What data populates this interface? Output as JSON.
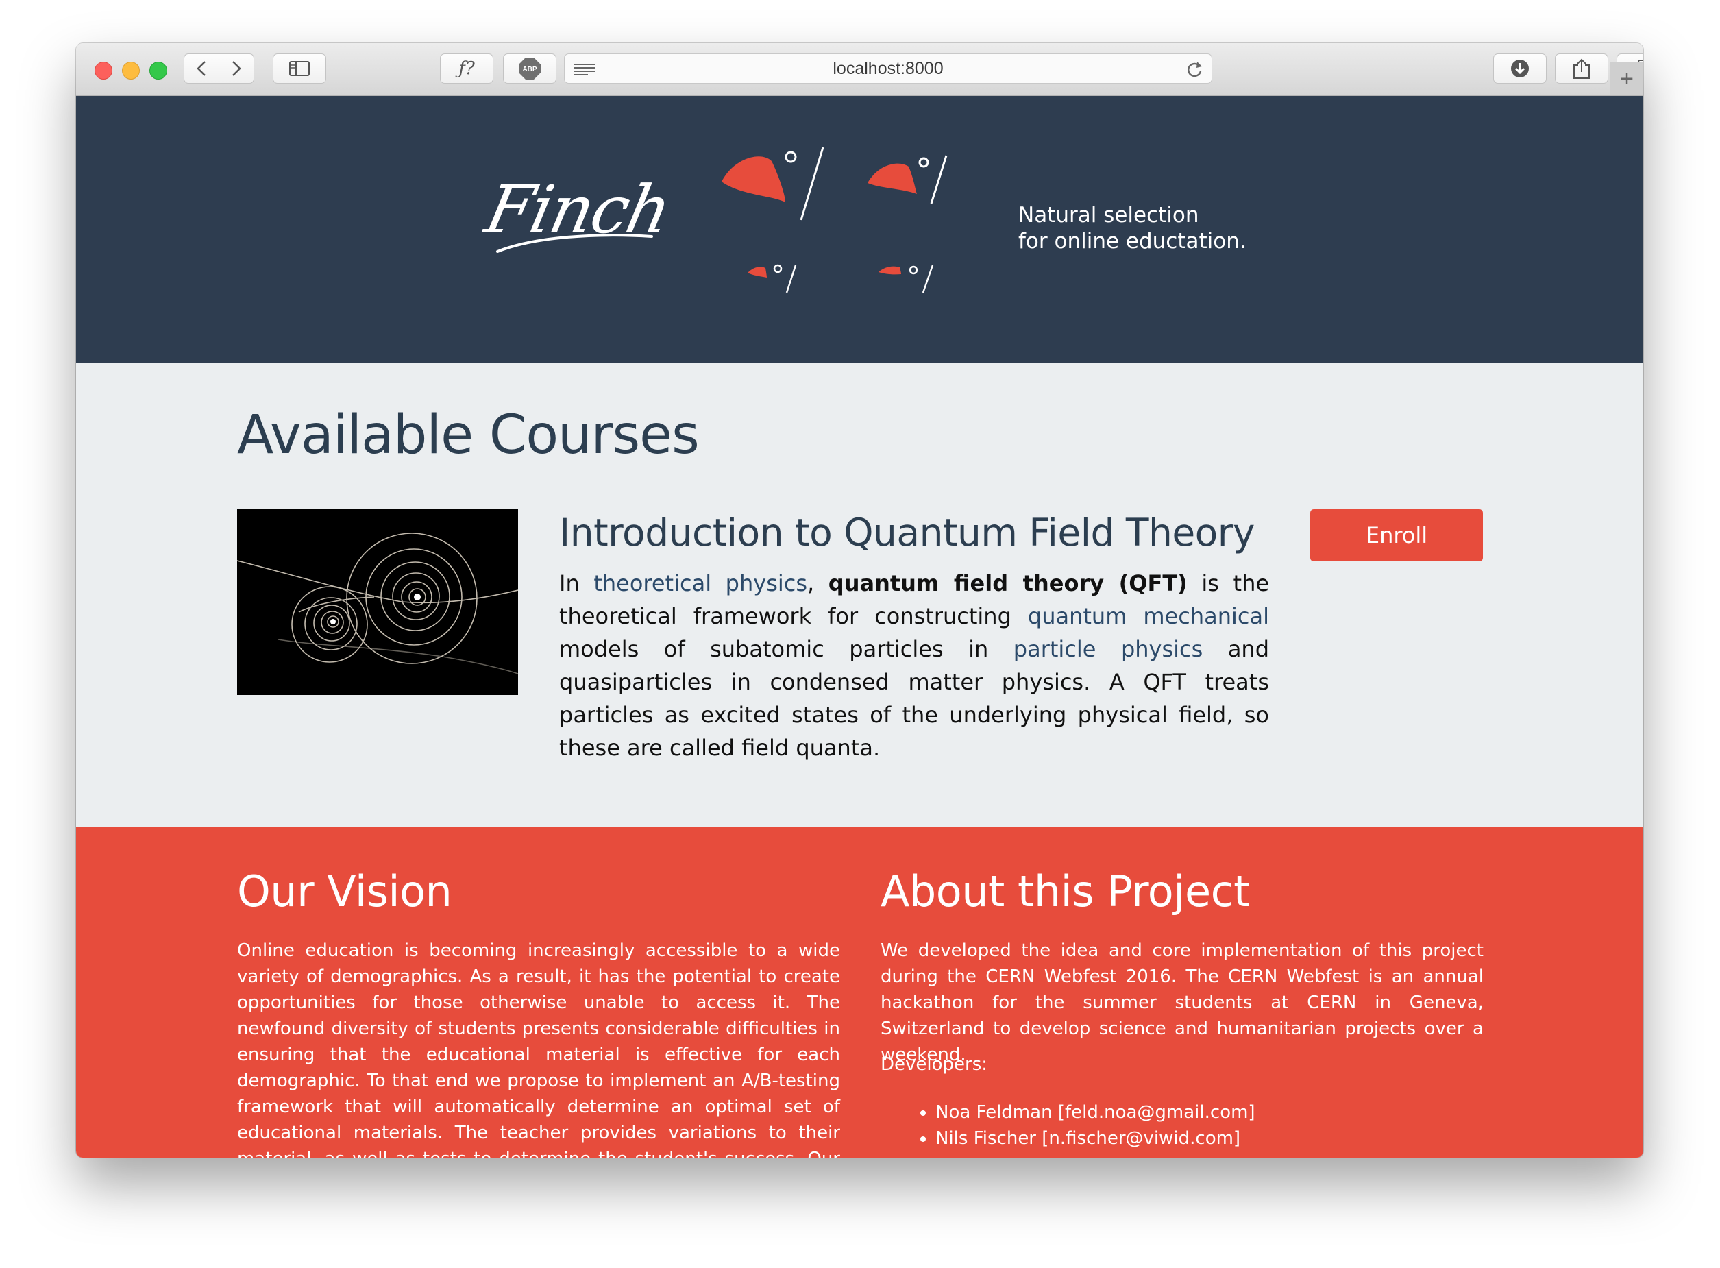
{
  "browser": {
    "url": "localhost:8000",
    "colors": {
      "close": "#fc605c",
      "minimize": "#fdbc40",
      "maximize": "#34c84a"
    }
  },
  "hero": {
    "logo": "Finch",
    "tagline_line1": "Natural selection",
    "tagline_line2": "for online eductation."
  },
  "courses": {
    "heading": "Available Courses",
    "items": [
      {
        "title": "Introduction to Quantum Field Theory",
        "desc_1": "In ",
        "link_1": "theoretical physics",
        "desc_2": ", ",
        "bold": "quantum field theory (QFT)",
        "desc_3": " is the theoretical framework for constructing ",
        "link_2": "quantum mechanical",
        "desc_4": " models of subatomic particles in ",
        "link_3": "particle physics",
        "desc_5": " and quasiparticles in condensed matter physics. A QFT treats particles as excited states of the underlying physical field, so these are called field quanta.",
        "enroll_label": "Enroll"
      }
    ]
  },
  "vision": {
    "heading": "Our Vision",
    "text": "Online education is becoming increasingly accessible to a wide variety of demographics. As a result, it has the potential to create opportunities for those otherwise unable to access it. The newfound diversity of students presents considerable difficulties in ensuring that the educational material is effective for each demographic. To that end we propose to implement an A/B-testing framework that will automatically determine an optimal set of educational materials. The teacher provides variations to their material, as well as tests to determine the student's success. Our A/B-testing based algorithm adjusts the content of the"
  },
  "about": {
    "heading": "About this Project",
    "text": "We developed the idea and core implementation of this project during the CERN Webfest 2016. The CERN Webfest is an annual hackathon for the summer students at CERN in Geneva, Switzerland to develop science and humanitarian projects over a weekend.",
    "developers_label": "Developers:",
    "developers": [
      "Noa Feldman [feld.noa@gmail.com]",
      "Nils Fischer [n.fischer@viwid.com]"
    ]
  },
  "colors": {
    "navy": "#2e3d50",
    "red": "#e74c3c",
    "light": "#ebeef0"
  }
}
